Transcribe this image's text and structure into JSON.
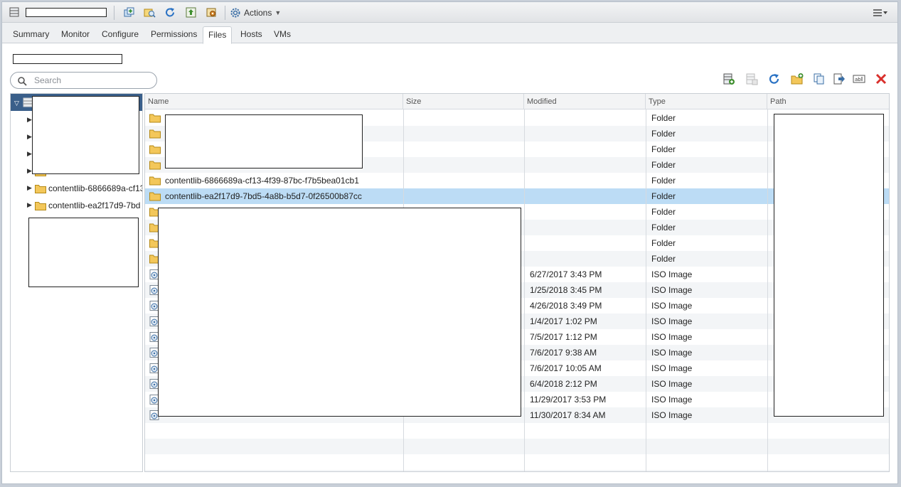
{
  "toolbar": {
    "actions_label": "Actions",
    "icons": [
      "host-icon",
      "new-vm-icon",
      "browse-icon",
      "refresh-icon",
      "upload-icon",
      "settings-icon",
      "actions-gear-icon",
      "menu-icon"
    ]
  },
  "tabs": [
    {
      "label": "Summary"
    },
    {
      "label": "Monitor"
    },
    {
      "label": "Configure"
    },
    {
      "label": "Permissions"
    },
    {
      "label": "Files",
      "active": true
    },
    {
      "label": "Hosts"
    },
    {
      "label": "VMs"
    }
  ],
  "search": {
    "placeholder": "Search",
    "value": ""
  },
  "tree": {
    "items": [
      {
        "label": "contentlib-6866689a-cf13"
      },
      {
        "label": "contentlib-ea2f17d9-7bd"
      }
    ]
  },
  "grid": {
    "columns": [
      "Name",
      "Size",
      "Modified",
      "Type",
      "Path"
    ],
    "rows": [
      {
        "name": "",
        "size": "",
        "modified": "",
        "type": "Folder",
        "kind": "folder"
      },
      {
        "name": "",
        "size": "",
        "modified": "",
        "type": "Folder",
        "kind": "folder"
      },
      {
        "name": "",
        "size": "",
        "modified": "",
        "type": "Folder",
        "kind": "folder"
      },
      {
        "name": "",
        "size": "",
        "modified": "",
        "type": "Folder",
        "kind": "folder"
      },
      {
        "name": "contentlib-6866689a-cf13-4f39-87bc-f7b5bea01cb1",
        "size": "",
        "modified": "",
        "type": "Folder",
        "kind": "folder"
      },
      {
        "name": "contentlib-ea2f17d9-7bd5-4a8b-b5d7-0f26500b87cc",
        "size": "",
        "modified": "",
        "type": "Folder",
        "kind": "folder",
        "selected": true
      },
      {
        "name": "",
        "size": "",
        "modified": "",
        "type": "Folder",
        "kind": "folder"
      },
      {
        "name": "",
        "size": "",
        "modified": "",
        "type": "Folder",
        "kind": "folder"
      },
      {
        "name": "",
        "size": "",
        "modified": "",
        "type": "Folder",
        "kind": "folder"
      },
      {
        "name": "",
        "size": "",
        "modified": "",
        "type": "Folder",
        "kind": "folder"
      },
      {
        "name": "",
        "size": "",
        "modified": "6/27/2017 3:43 PM",
        "type": "ISO Image",
        "kind": "iso"
      },
      {
        "name": "",
        "size": "",
        "modified": "1/25/2018 3:45 PM",
        "type": "ISO Image",
        "kind": "iso"
      },
      {
        "name": "",
        "size": "",
        "modified": "4/26/2018 3:49 PM",
        "type": "ISO Image",
        "kind": "iso"
      },
      {
        "name": "",
        "size": "",
        "modified": "1/4/2017 1:02 PM",
        "type": "ISO Image",
        "kind": "iso"
      },
      {
        "name": "",
        "size": "",
        "modified": "7/5/2017 1:12 PM",
        "type": "ISO Image",
        "kind": "iso"
      },
      {
        "name": "",
        "size": "",
        "modified": "7/6/2017 9:38 AM",
        "type": "ISO Image",
        "kind": "iso"
      },
      {
        "name": "",
        "size": "",
        "modified": "7/6/2017 10:05 AM",
        "type": "ISO Image",
        "kind": "iso"
      },
      {
        "name": "",
        "size": "",
        "modified": "6/4/2018 2:12 PM",
        "type": "ISO Image",
        "kind": "iso"
      },
      {
        "name": "",
        "size": "",
        "modified": "11/29/2017 3:53 PM",
        "type": "ISO Image",
        "kind": "iso"
      },
      {
        "name": "",
        "size": "",
        "modified": "11/30/2017 8:34 AM",
        "type": "ISO Image",
        "kind": "iso"
      }
    ]
  },
  "right_tools": [
    "register-vm-icon",
    "inflate-icon",
    "refresh-icon",
    "new-folder-icon",
    "copy-icon",
    "move-icon",
    "rename-icon",
    "delete-icon"
  ],
  "colors": {
    "selection": "#bcdcf5",
    "tree_selected": "#3a5f8a",
    "delete": "#d9302c",
    "refresh": "#2a72c4",
    "folder": "#f3c75a"
  }
}
